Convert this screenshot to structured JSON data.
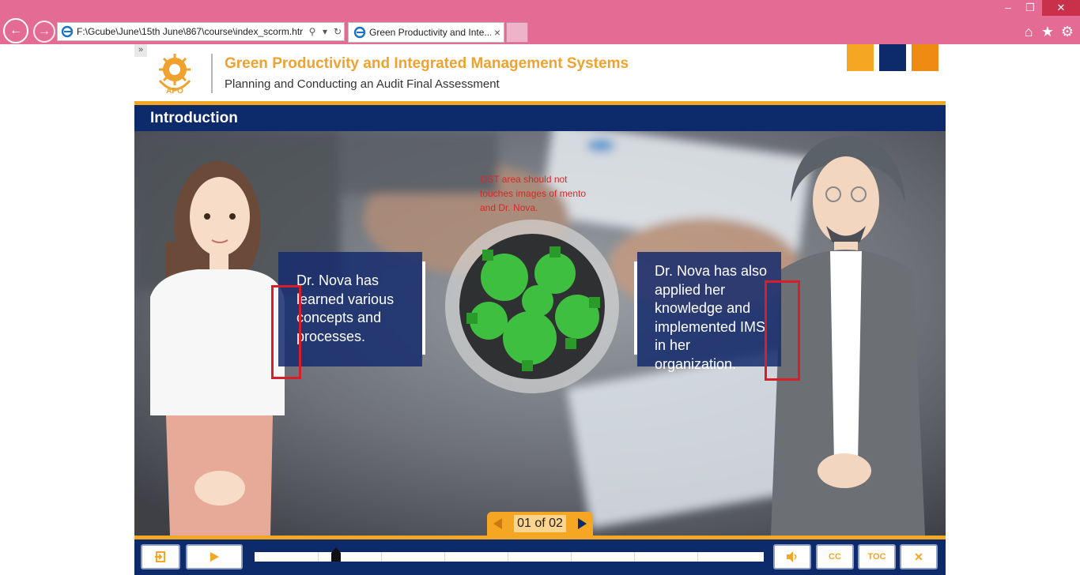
{
  "browser": {
    "address_url": "F:\\Gcube\\June\\15th June\\867\\course\\index_scorm.htr",
    "tab_title": "Green Productivity and Inte...",
    "tab_close": "×",
    "window_min": "–",
    "window_restore": "❐",
    "window_close": "✕",
    "icons": [
      "back-arrow-icon",
      "forward-arrow-icon",
      "ie-icon",
      "search-icon",
      "dropdown-icon",
      "refresh-icon",
      "home-icon",
      "favorites-star-icon",
      "settings-gear-icon"
    ]
  },
  "course": {
    "collapse_label": "»",
    "logo_text": "APO",
    "title": "Green Productivity and Integrated Management Systems",
    "subtitle": "Planning and Conducting an Audit Final Assessment",
    "brand_colors": [
      "#f5a623",
      "#0d2a6b",
      "#ef8a12"
    ]
  },
  "slide": {
    "title": "Introduction",
    "review_note": "OST area should not touches images of mento and Dr. Nova.",
    "bubble_left": "Dr. Nova has learned various concepts and processes.",
    "bubble_right": "Dr. Nova has also applied her knowledge and implemented IMS in her organization.",
    "page_counter": "01 of 02"
  },
  "player": {
    "exit_label": "exit-icon",
    "play_label": "play-icon",
    "audio_label": "audio-icon",
    "cc_label": "CC",
    "toc_label": "TOC",
    "close_label": "✕",
    "progress": 0.16
  }
}
